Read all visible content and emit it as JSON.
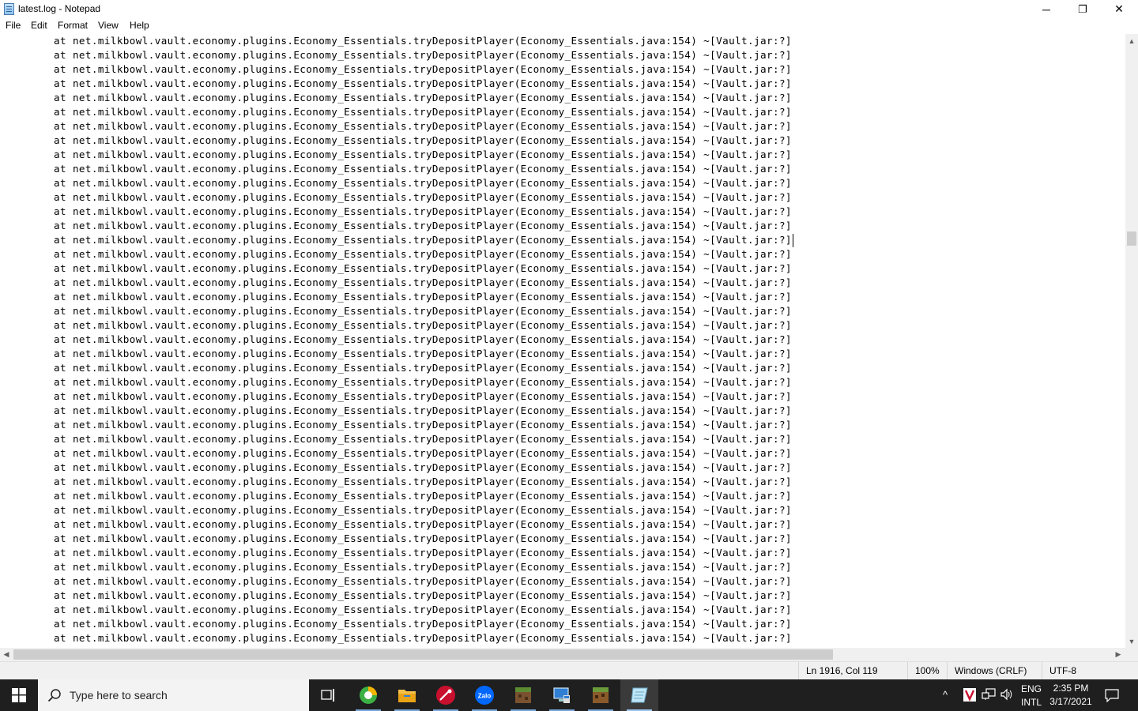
{
  "window": {
    "title": "latest.log - Notepad",
    "controls": {
      "minimize": "─",
      "maximize": "❐",
      "close": "✕"
    }
  },
  "menu": [
    "File",
    "Edit",
    "Format",
    "View",
    "Help"
  ],
  "editor": {
    "lines": [
      "at net.milkbowl.vault.economy.plugins.Economy_Essentials.tryDepositPlayer(Economy_Essentials.java:154) ~[Vault.jar:?]",
      "at net.milkbowl.vault.economy.plugins.Economy_Essentials.tryDepositPlayer(Economy_Essentials.java:154) ~[Vault.jar:?]",
      "at net.milkbowl.vault.economy.plugins.Economy_Essentials.tryDepositPlayer(Economy_Essentials.java:154) ~[Vault.jar:?]",
      "at net.milkbowl.vault.economy.plugins.Economy_Essentials.tryDepositPlayer(Economy_Essentials.java:154) ~[Vault.jar:?]",
      "at net.milkbowl.vault.economy.plugins.Economy_Essentials.tryDepositPlayer(Economy_Essentials.java:154) ~[Vault.jar:?]",
      "at net.milkbowl.vault.economy.plugins.Economy_Essentials.tryDepositPlayer(Economy_Essentials.java:154) ~[Vault.jar:?]",
      "at net.milkbowl.vault.economy.plugins.Economy_Essentials.tryDepositPlayer(Economy_Essentials.java:154) ~[Vault.jar:?]",
      "at net.milkbowl.vault.economy.plugins.Economy_Essentials.tryDepositPlayer(Economy_Essentials.java:154) ~[Vault.jar:?]",
      "at net.milkbowl.vault.economy.plugins.Economy_Essentials.tryDepositPlayer(Economy_Essentials.java:154) ~[Vault.jar:?]",
      "at net.milkbowl.vault.economy.plugins.Economy_Essentials.tryDepositPlayer(Economy_Essentials.java:154) ~[Vault.jar:?]",
      "at net.milkbowl.vault.economy.plugins.Economy_Essentials.tryDepositPlayer(Economy_Essentials.java:154) ~[Vault.jar:?]",
      "at net.milkbowl.vault.economy.plugins.Economy_Essentials.tryDepositPlayer(Economy_Essentials.java:154) ~[Vault.jar:?]",
      "at net.milkbowl.vault.economy.plugins.Economy_Essentials.tryDepositPlayer(Economy_Essentials.java:154) ~[Vault.jar:?]",
      "at net.milkbowl.vault.economy.plugins.Economy_Essentials.tryDepositPlayer(Economy_Essentials.java:154) ~[Vault.jar:?]",
      "at net.milkbowl.vault.economy.plugins.Economy_Essentials.tryDepositPlayer(Economy_Essentials.java:154) ~[Vault.jar:?]",
      "at net.milkbowl.vault.economy.plugins.Economy_Essentials.tryDepositPlayer(Economy_Essentials.java:154) ~[Vault.jar:?]",
      "at net.milkbowl.vault.economy.plugins.Economy_Essentials.tryDepositPlayer(Economy_Essentials.java:154) ~[Vault.jar:?]",
      "at net.milkbowl.vault.economy.plugins.Economy_Essentials.tryDepositPlayer(Economy_Essentials.java:154) ~[Vault.jar:?]",
      "at net.milkbowl.vault.economy.plugins.Economy_Essentials.tryDepositPlayer(Economy_Essentials.java:154) ~[Vault.jar:?]",
      "at net.milkbowl.vault.economy.plugins.Economy_Essentials.tryDepositPlayer(Economy_Essentials.java:154) ~[Vault.jar:?]",
      "at net.milkbowl.vault.economy.plugins.Economy_Essentials.tryDepositPlayer(Economy_Essentials.java:154) ~[Vault.jar:?]",
      "at net.milkbowl.vault.economy.plugins.Economy_Essentials.tryDepositPlayer(Economy_Essentials.java:154) ~[Vault.jar:?]",
      "at net.milkbowl.vault.economy.plugins.Economy_Essentials.tryDepositPlayer(Economy_Essentials.java:154) ~[Vault.jar:?]",
      "at net.milkbowl.vault.economy.plugins.Economy_Essentials.tryDepositPlayer(Economy_Essentials.java:154) ~[Vault.jar:?]",
      "at net.milkbowl.vault.economy.plugins.Economy_Essentials.tryDepositPlayer(Economy_Essentials.java:154) ~[Vault.jar:?]",
      "at net.milkbowl.vault.economy.plugins.Economy_Essentials.tryDepositPlayer(Economy_Essentials.java:154) ~[Vault.jar:?]",
      "at net.milkbowl.vault.economy.plugins.Economy_Essentials.tryDepositPlayer(Economy_Essentials.java:154) ~[Vault.jar:?]",
      "at net.milkbowl.vault.economy.plugins.Economy_Essentials.tryDepositPlayer(Economy_Essentials.java:154) ~[Vault.jar:?]",
      "at net.milkbowl.vault.economy.plugins.Economy_Essentials.tryDepositPlayer(Economy_Essentials.java:154) ~[Vault.jar:?]",
      "at net.milkbowl.vault.economy.plugins.Economy_Essentials.tryDepositPlayer(Economy_Essentials.java:154) ~[Vault.jar:?]",
      "at net.milkbowl.vault.economy.plugins.Economy_Essentials.tryDepositPlayer(Economy_Essentials.java:154) ~[Vault.jar:?]",
      "at net.milkbowl.vault.economy.plugins.Economy_Essentials.tryDepositPlayer(Economy_Essentials.java:154) ~[Vault.jar:?]",
      "at net.milkbowl.vault.economy.plugins.Economy_Essentials.tryDepositPlayer(Economy_Essentials.java:154) ~[Vault.jar:?]",
      "at net.milkbowl.vault.economy.plugins.Economy_Essentials.tryDepositPlayer(Economy_Essentials.java:154) ~[Vault.jar:?]",
      "at net.milkbowl.vault.economy.plugins.Economy_Essentials.tryDepositPlayer(Economy_Essentials.java:154) ~[Vault.jar:?]",
      "at net.milkbowl.vault.economy.plugins.Economy_Essentials.tryDepositPlayer(Economy_Essentials.java:154) ~[Vault.jar:?]",
      "at net.milkbowl.vault.economy.plugins.Economy_Essentials.tryDepositPlayer(Economy_Essentials.java:154) ~[Vault.jar:?]",
      "at net.milkbowl.vault.economy.plugins.Economy_Essentials.tryDepositPlayer(Economy_Essentials.java:154) ~[Vault.jar:?]",
      "at net.milkbowl.vault.economy.plugins.Economy_Essentials.tryDepositPlayer(Economy_Essentials.java:154) ~[Vault.jar:?]",
      "at net.milkbowl.vault.economy.plugins.Economy_Essentials.tryDepositPlayer(Economy_Essentials.java:154) ~[Vault.jar:?]",
      "at net.milkbowl.vault.economy.plugins.Economy_Essentials.tryDepositPlayer(Economy_Essentials.java:154) ~[Vault.jar:?]",
      "at net.milkbowl.vault.economy.plugins.Economy_Essentials.tryDepositPlayer(Economy_Essentials.java:154) ~[Vault.jar:?]",
      "at net.milkbowl.vault.economy.plugins.Economy_Essentials.tryDepositPlayer(Economy_Essentials.java:154) ~[Vault.jar:?]"
    ]
  },
  "status": {
    "position": "Ln 1916, Col 119",
    "zoom": "100%",
    "line_ending": "Windows (CRLF)",
    "encoding": "UTF-8"
  },
  "taskbar": {
    "search_placeholder": "Type here to search",
    "apps": [
      {
        "name": "task-view-icon"
      },
      {
        "name": "browser-icon"
      },
      {
        "name": "file-explorer-icon"
      },
      {
        "name": "red-app-icon"
      },
      {
        "name": "zalo-icon",
        "label": "Zalo"
      },
      {
        "name": "minecraft-icon"
      },
      {
        "name": "remote-desktop-icon"
      },
      {
        "name": "minecraft-server-icon"
      },
      {
        "name": "notepad-icon"
      }
    ],
    "tray": {
      "lang": "ENG",
      "layout": "INTL",
      "time": "2:35 PM",
      "date": "3/17/2021"
    }
  },
  "colors": {
    "taskbar_bg": "#1f1f1f",
    "accent": "#7aa7d9"
  }
}
